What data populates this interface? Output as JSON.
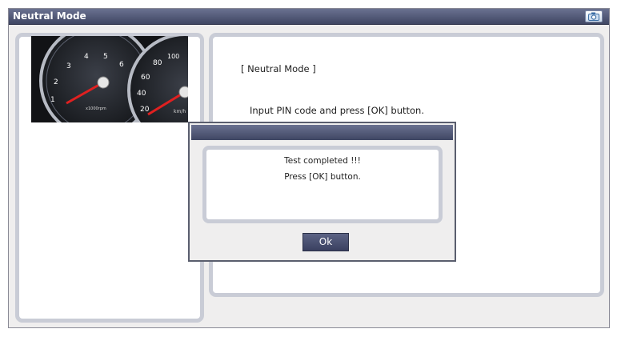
{
  "window": {
    "title": "Neutral Mode"
  },
  "main": {
    "mode_label": "[ Neutral Mode ]",
    "prompt": "Input PIN code and press [OK] button."
  },
  "dialog": {
    "message_line1": "Test completed !!!",
    "message_line2": "Press [OK] button.",
    "ok_label": "Ok"
  },
  "instrument_cluster": {
    "tachometer_ticks": [
      "1",
      "2",
      "3",
      "4",
      "5",
      "6"
    ],
    "tachometer_unit": "x1000rpm",
    "speedometer_ticks": [
      "20",
      "40",
      "60",
      "80",
      "100"
    ],
    "speedometer_unit": "km/h"
  },
  "icons": {
    "camera": "camera-icon"
  },
  "colors": {
    "titlebar": "#4a5170",
    "panel_border": "#c9ccd6",
    "needle": "#e02020"
  }
}
